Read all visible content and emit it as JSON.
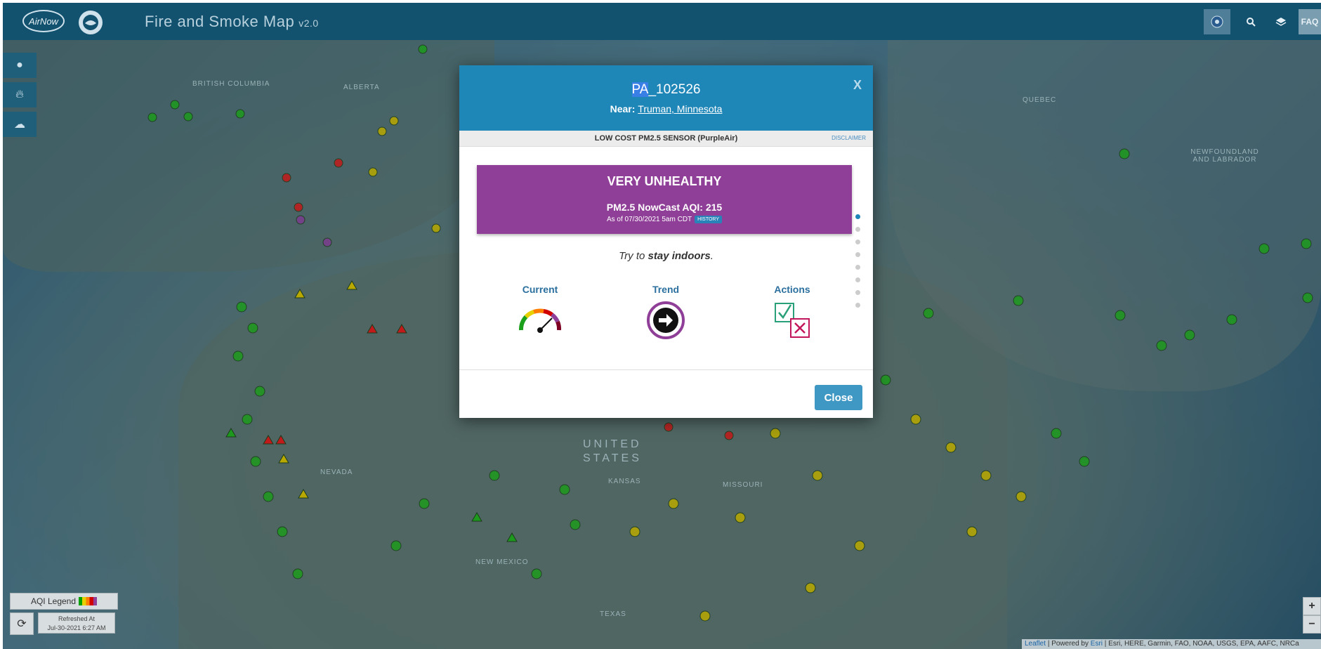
{
  "header": {
    "logo_text": "AirNow",
    "title": "Fire and Smoke Map",
    "version": "v2.0",
    "faq_label": "FAQ"
  },
  "map": {
    "labels": [
      "BRITISH COLUMBIA",
      "ALBERTA",
      "QUEBEC",
      "NEWFOUNDLAND AND LABRADOR",
      "UNITED STATES",
      "NEVADA",
      "NEW MEXICO",
      "TEXAS",
      "MISSOURI",
      "KANSAS"
    ]
  },
  "legend": {
    "label": "AQI Legend"
  },
  "refreshed": {
    "line1": "Refreshed At",
    "line2": "Jul-30-2021 6:27 AM"
  },
  "zoom": {
    "in": "+",
    "out": "−"
  },
  "attribution": {
    "leaflet": "Leaflet",
    "powered_by": "| Powered by",
    "esri": "Esri",
    "rest": "| Esri, HERE, Garmin, FAO, NOAA, USGS, EPA, AAFC, NRCa"
  },
  "modal": {
    "site_id_prefix": "PA",
    "site_id_suffix": "_102526",
    "near_label": "Near:",
    "near_place": "Truman, Minnesota",
    "close_x": "X",
    "sensor_type": "LOW COST PM2.5 SENSOR (PurpleAir)",
    "disclaimer": "DISCLAIMER",
    "category": "VERY UNHEALTHY",
    "aqi_text": "PM2.5 NowCast AQI: 215",
    "as_of": "As of 07/30/2021 5am CDT",
    "history": "HISTORY",
    "advice_prefix": "Try to",
    "advice_bold": "stay indoors",
    "advice_suffix": ".",
    "nav": {
      "current": "Current",
      "trend": "Trend",
      "actions": "Actions"
    },
    "close_button": "Close",
    "page_count": 8,
    "active_page": 1
  },
  "colors": {
    "header": "#12526f",
    "modal_header": "#1f86b8",
    "very_unhealthy": "#8f3f97",
    "close_button": "#3f97c4"
  }
}
